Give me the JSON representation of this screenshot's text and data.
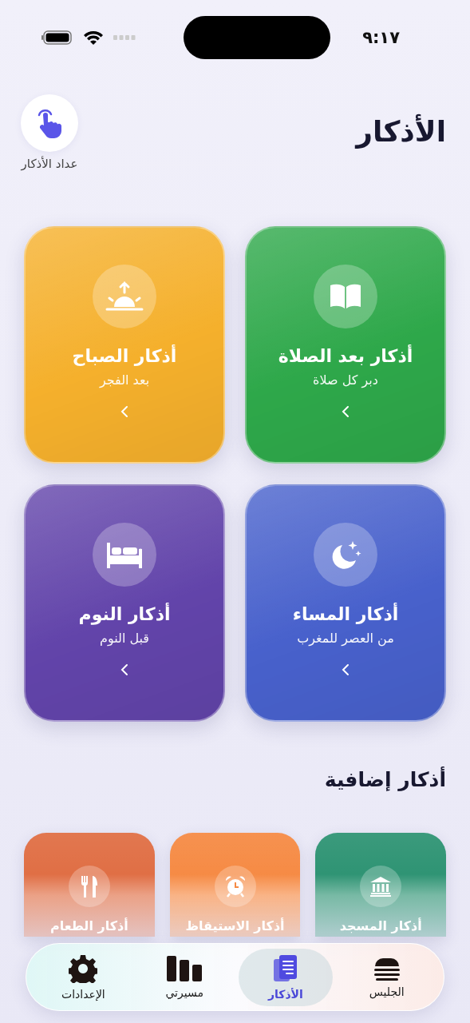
{
  "status_bar": {
    "time": "٩:١٧"
  },
  "header": {
    "title": "الأذكار",
    "counter_label": "عداد الأذكار"
  },
  "cards": [
    {
      "title": "أذكار بعد الصلاة",
      "subtitle": "دبر كل صلاة",
      "color": "#2ea84a"
    },
    {
      "title": "أذكار الصباح",
      "subtitle": "بعد الفجر",
      "color": "#f5b02c"
    },
    {
      "title": "أذكار المساء",
      "subtitle": "من العصر للمغرب",
      "color": "#4861cc"
    },
    {
      "title": "أذكار النوم",
      "subtitle": "قبل النوم",
      "color": "#6244aa"
    }
  ],
  "section_title": "أذكار إضافية",
  "extra_cards": [
    {
      "title": "أذكار المسجد",
      "color": "#2f9474"
    },
    {
      "title": "أذكار الاستيقاظ",
      "color": "#f68b45"
    },
    {
      "title": "أذكار الطعام",
      "color": "#e06f45"
    }
  ],
  "tabs": [
    {
      "label": "الجليس",
      "selected": false
    },
    {
      "label": "الأذكار",
      "selected": true
    },
    {
      "label": "مسيرتي",
      "selected": false
    },
    {
      "label": "الإعدادات",
      "selected": false
    }
  ]
}
